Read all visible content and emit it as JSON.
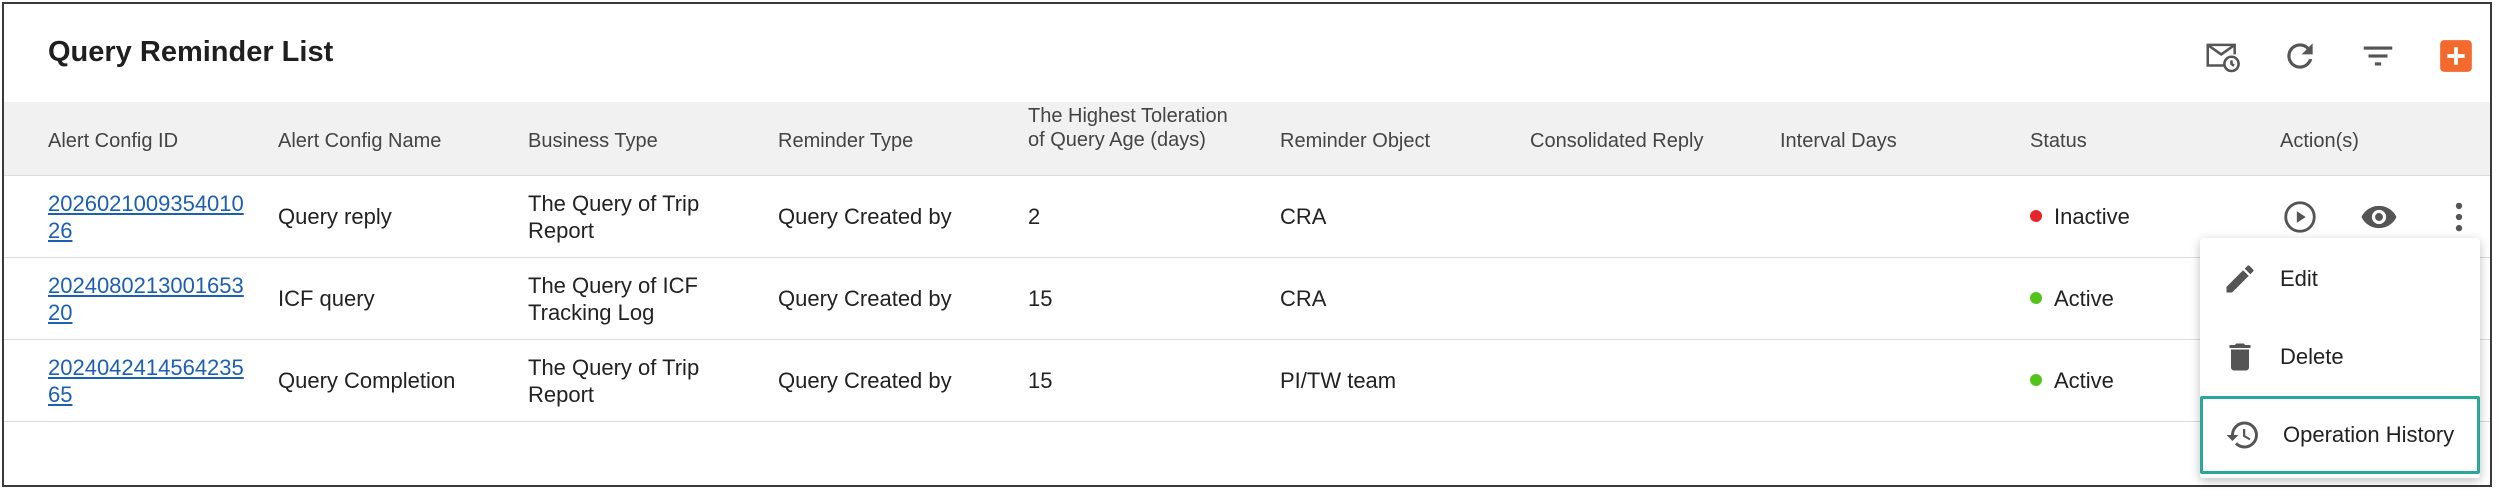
{
  "header": {
    "title": "Query Reminder List"
  },
  "toolbar": [
    {
      "icon": "mail-schedule-icon"
    },
    {
      "icon": "refresh-icon"
    },
    {
      "icon": "filter-icon"
    },
    {
      "icon": "add-icon"
    }
  ],
  "colors": {
    "accent": "#f26a2e",
    "link": "#1c5fb4",
    "inactive": "#e5252b",
    "active": "#52c41a",
    "highlight": "#2aa79a"
  },
  "columns": [
    "Alert Config ID",
    "Alert Config Name",
    "Business Type",
    "Reminder Type",
    "The Highest Toleration of Query Age (days)",
    "Reminder Object",
    "Consolidated Reply",
    "Interval Days",
    "Status",
    "Action(s)"
  ],
  "rows": [
    {
      "id": "202602100935401026",
      "name": "Query reply",
      "business_type": "The Query of Trip Report",
      "reminder_type": "Query Created by",
      "toleration": "2",
      "object": "CRA",
      "consolidated": "",
      "interval": "",
      "status": "Inactive"
    },
    {
      "id": "202408021300165320",
      "name": "ICF query",
      "business_type": "The Query of ICF Tracking Log",
      "reminder_type": "Query Created by",
      "toleration": "15",
      "object": "CRA",
      "consolidated": "",
      "interval": "",
      "status": "Active"
    },
    {
      "id": "202404241456423565",
      "name": "Query Completion",
      "business_type": "The Query of Trip Report",
      "reminder_type": "Query Created by",
      "toleration": "15",
      "object": "PI/TW team",
      "consolidated": "",
      "interval": "",
      "status": "Active"
    }
  ],
  "row_actions": {
    "start": "play-circle-icon",
    "view": "eye-icon",
    "more": "more-vertical-icon"
  },
  "menu": {
    "items": [
      {
        "label": "Edit",
        "icon": "pencil-icon"
      },
      {
        "label": "Delete",
        "icon": "trash-icon"
      },
      {
        "label": "Operation History",
        "icon": "history-icon"
      }
    ]
  }
}
